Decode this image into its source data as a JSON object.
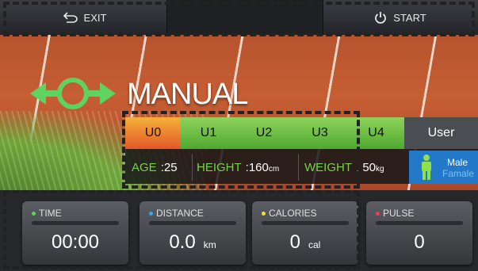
{
  "topbar": {
    "exit_label": "EXIT",
    "start_label": "START"
  },
  "program": {
    "title": "MANUAL"
  },
  "user_tabs": [
    "U0",
    "U1",
    "U2",
    "U3",
    "U4"
  ],
  "active_tab": "U0",
  "user_tab_label": "User",
  "profile": {
    "age_label": "AGE",
    "age_value": ":25",
    "height_label": "HEIGHT",
    "height_value": ":160",
    "height_unit": "cm",
    "weight_label": "WEIGHT",
    "weight_value": ":  50",
    "weight_unit": "kg",
    "gender_male": "Male",
    "gender_female": "Famale"
  },
  "metrics": [
    {
      "label": "TIME",
      "value": "00:00",
      "unit": "",
      "color": "#5fd35f"
    },
    {
      "label": "DISTANCE",
      "value": "0.0",
      "unit": "km",
      "color": "#3aa8f0"
    },
    {
      "label": "CALORIES",
      "value": "0",
      "unit": "cal",
      "color": "#f0e040"
    },
    {
      "label": "PULSE",
      "value": "0",
      "unit": "",
      "color": "#f04040"
    }
  ],
  "colors": {
    "accent_green": "#78d048",
    "active_tab_orange": "#e4572a",
    "gender_blue": "#2478c8"
  }
}
